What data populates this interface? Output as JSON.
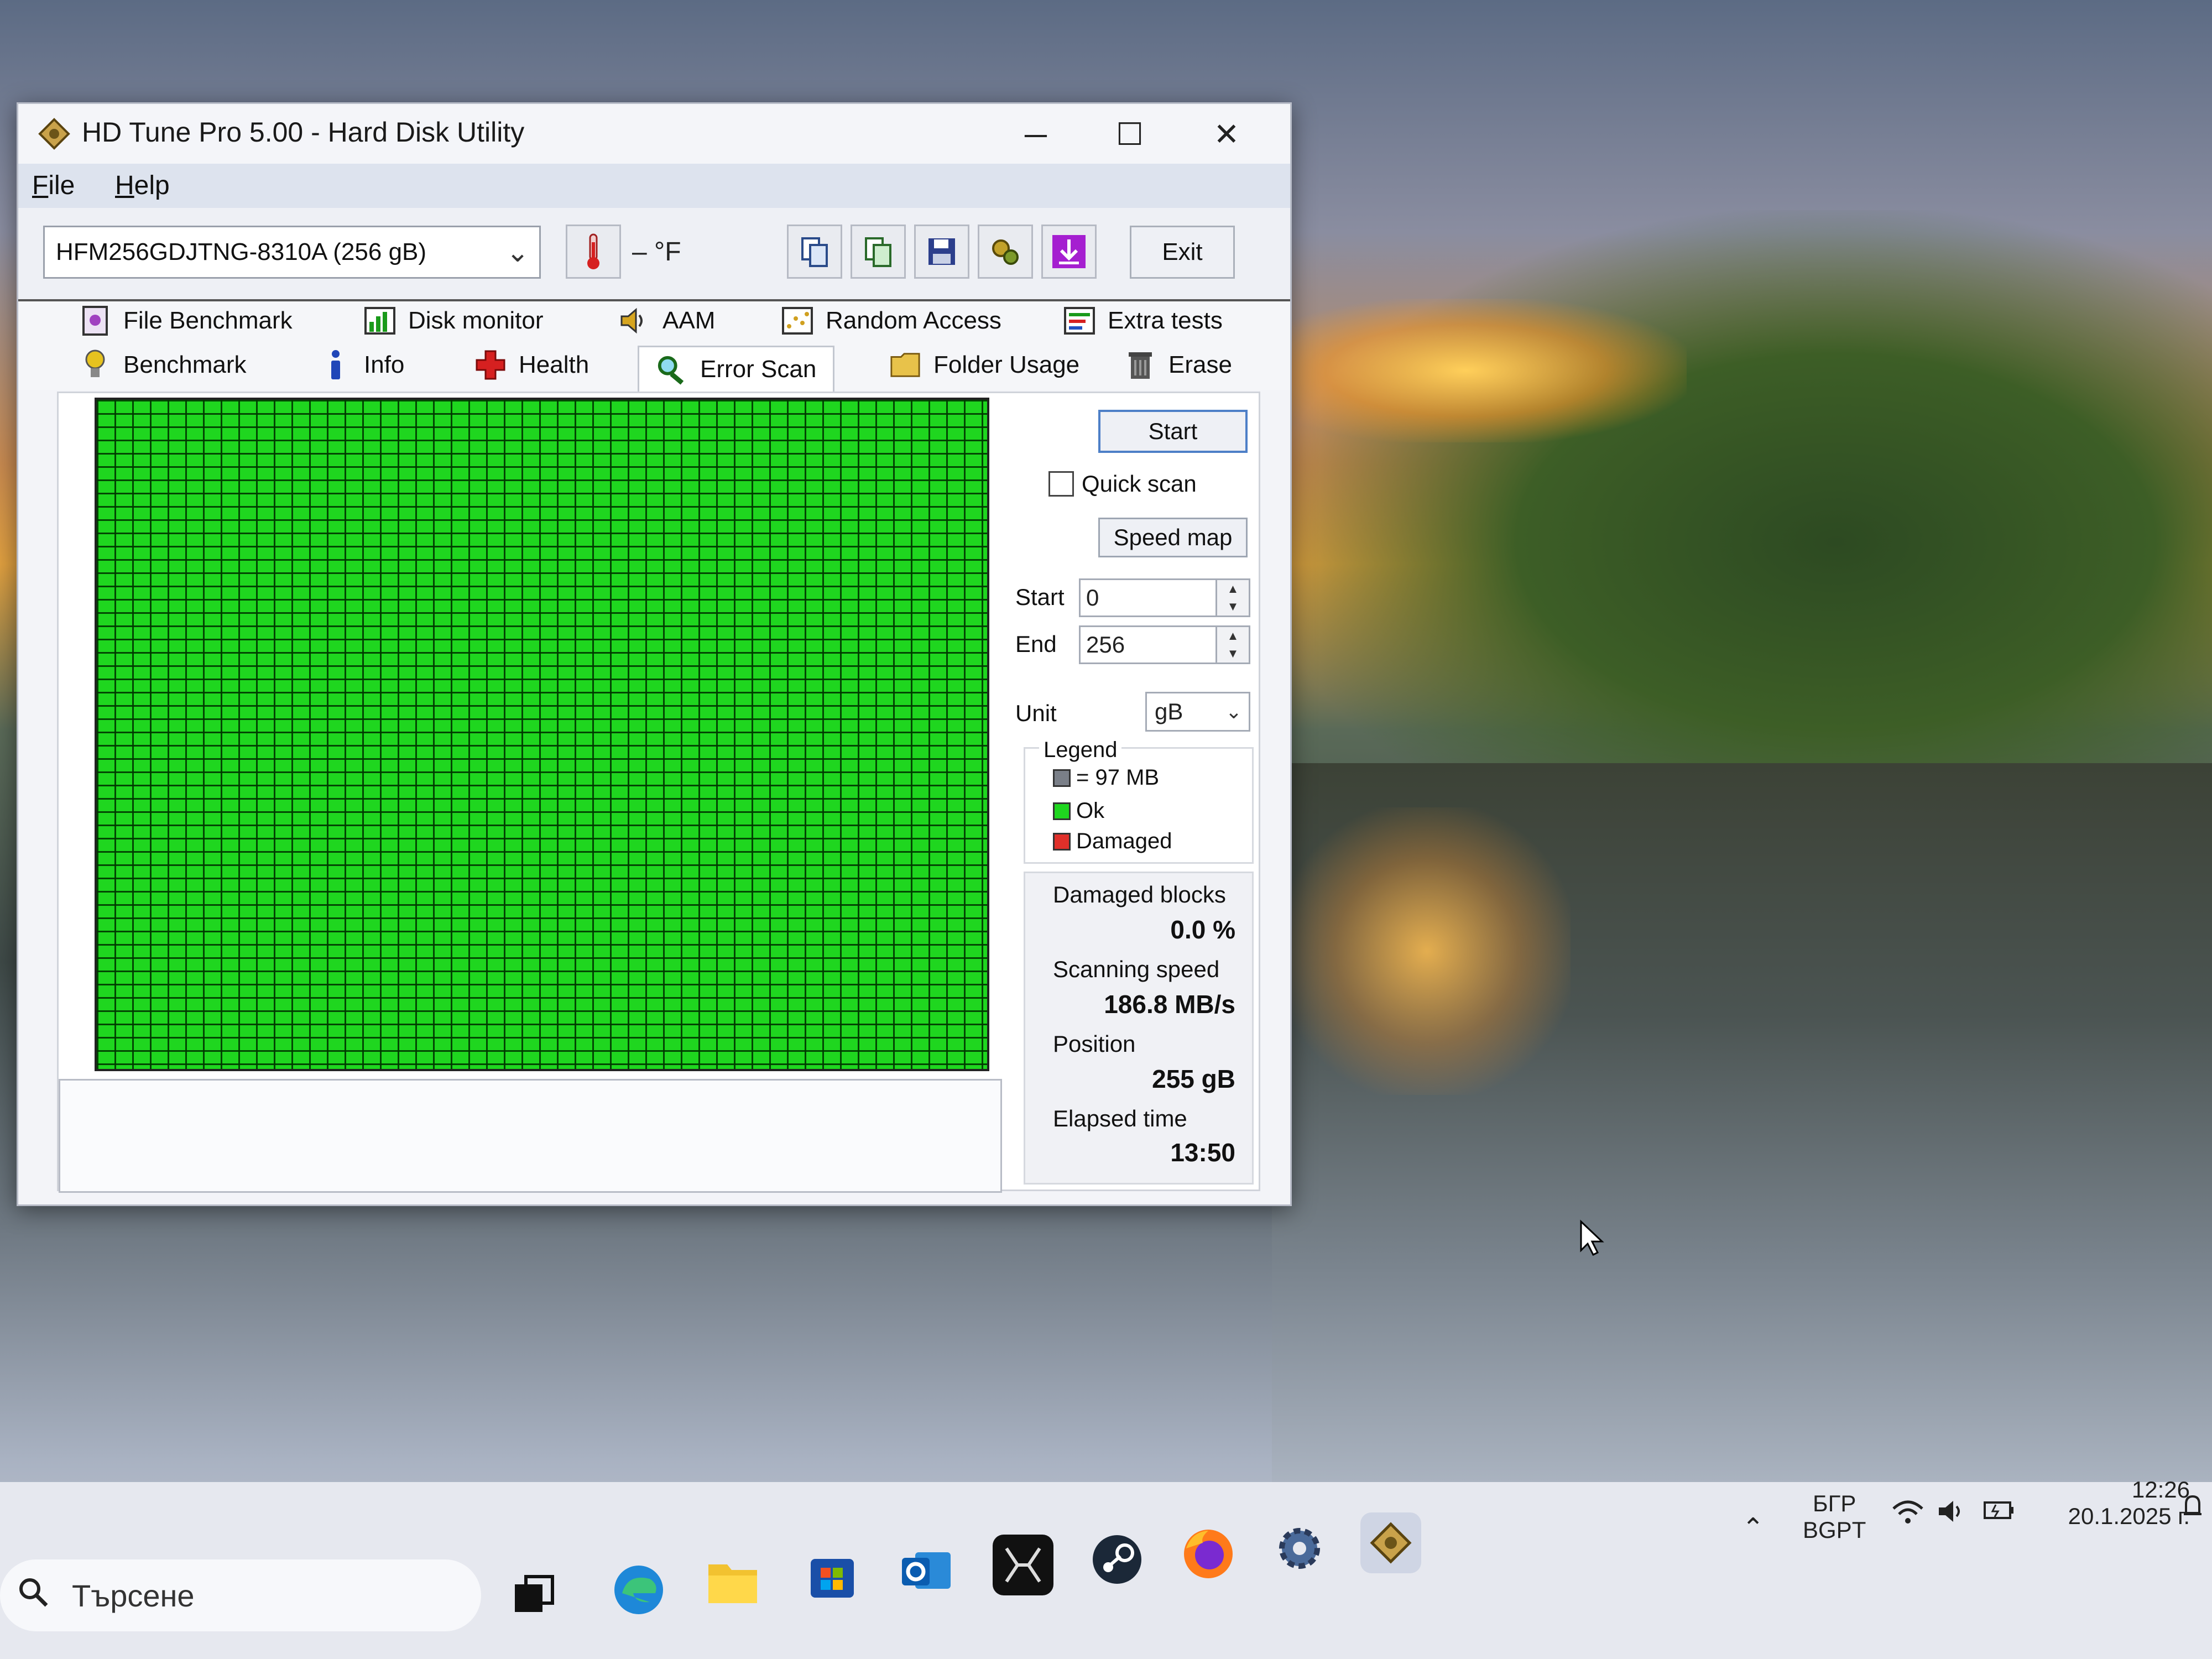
{
  "window": {
    "title": "HD Tune Pro 5.00 - Hard Disk Utility",
    "minimize": "─",
    "maximize": "☐",
    "close": "✕"
  },
  "menu": {
    "file": "File",
    "help": "Help"
  },
  "toolbar": {
    "drive": "HFM256GDJTNG-8310A (256 gB)",
    "temperature": "– °F",
    "exit": "Exit"
  },
  "tabs": {
    "row1": [
      "File Benchmark",
      "Disk monitor",
      "AAM",
      "Random Access",
      "Extra tests"
    ],
    "row2": [
      "Benchmark",
      "Info",
      "Health",
      "Error Scan",
      "Folder Usage",
      "Erase"
    ],
    "active": "Error Scan"
  },
  "scan": {
    "start_button": "Start",
    "quick_scan_label": "Quick scan",
    "quick_scan_checked": false,
    "speed_map_button": "Speed map",
    "start_label": "Start",
    "start_value": "0",
    "end_label": "End",
    "end_value": "256",
    "unit_label": "Unit",
    "unit_value": "gB",
    "block_status": "all ok"
  },
  "legend": {
    "title": "Legend",
    "block_size": "= 97 MB",
    "ok": "Ok",
    "damaged": "Damaged",
    "colors": {
      "block": "#7a7f88",
      "ok": "#1fd61f",
      "damaged": "#e0302a"
    }
  },
  "stats": {
    "damaged_blocks_label": "Damaged blocks",
    "damaged_blocks_value": "0.0 %",
    "scanning_speed_label": "Scanning speed",
    "scanning_speed_value": "186.8 MB/s",
    "position_label": "Position",
    "position_value": "255 gB",
    "elapsed_label": "Elapsed time",
    "elapsed_value": "13:50"
  },
  "taskbar": {
    "search_placeholder": "Търсене",
    "language_top": "БГР",
    "language_bottom": "BGPT",
    "time": "12:26",
    "date": "20.1.2025 г."
  }
}
